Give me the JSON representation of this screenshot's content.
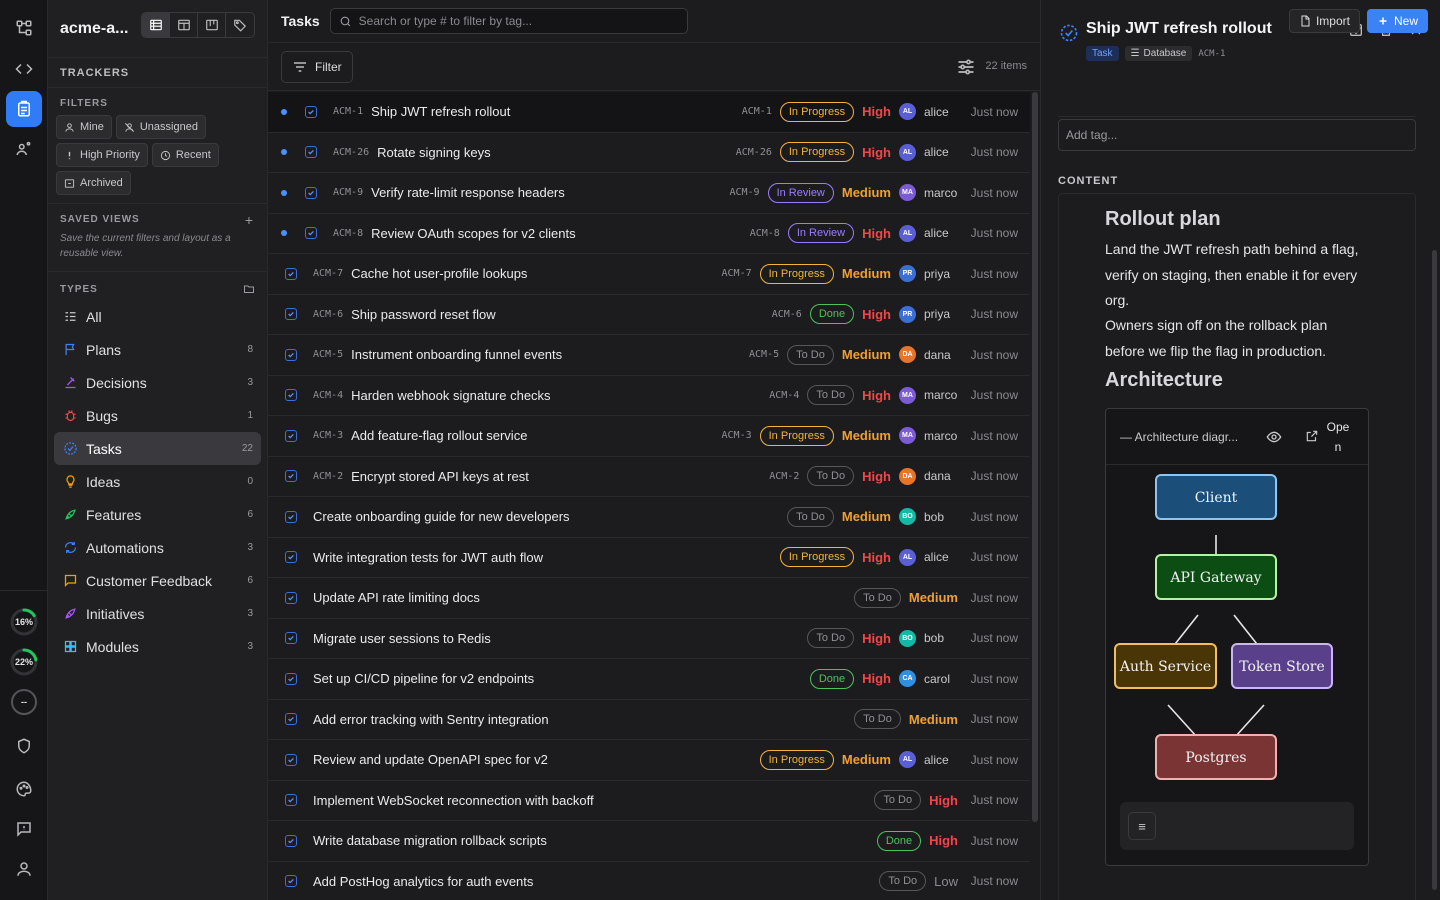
{
  "workspace": {
    "name": "acme-a..."
  },
  "sidebar": {
    "trackers_title": "TRACKERS",
    "filters_title": "FILTERS",
    "filter_chips": [
      {
        "label": "Mine",
        "icon": "user-icon"
      },
      {
        "label": "Unassigned",
        "icon": "user-off-icon"
      },
      {
        "label": "High Priority",
        "icon": "exclamation-icon"
      },
      {
        "label": "Recent",
        "icon": "clock-icon"
      },
      {
        "label": "Archived",
        "icon": "archive-icon"
      }
    ],
    "saved_views_title": "SAVED VIEWS",
    "saved_views_hint": "Save the current filters and layout as a reusable view.",
    "types_title": "TYPES",
    "types": [
      {
        "label": "All",
        "count": "",
        "color": "#c9c9cd"
      },
      {
        "label": "Plans",
        "count": "8",
        "color": "#3b82f6"
      },
      {
        "label": "Decisions",
        "count": "3",
        "color": "#a855f7"
      },
      {
        "label": "Bugs",
        "count": "1",
        "color": "#ef4444"
      },
      {
        "label": "Tasks",
        "count": "22",
        "color": "#3b82f6"
      },
      {
        "label": "Ideas",
        "count": "0",
        "color": "#f59e0b"
      },
      {
        "label": "Features",
        "count": "6",
        "color": "#22c55e"
      },
      {
        "label": "Automations",
        "count": "3",
        "color": "#3b82f6"
      },
      {
        "label": "Customer Feedback",
        "count": "6",
        "color": "#f59e0b"
      },
      {
        "label": "Initiatives",
        "count": "3",
        "color": "#a855f7"
      },
      {
        "label": "Modules",
        "count": "3",
        "color": "#38bdf8"
      }
    ]
  },
  "rail": {
    "progress": [
      {
        "label": "16%",
        "value": 0.16
      },
      {
        "label": "22%",
        "value": 0.22
      },
      {
        "label": "--",
        "value": 0
      }
    ]
  },
  "header": {
    "title": "Tasks",
    "search_placeholder": "Search or type # to filter by tag...",
    "import_label": "Import",
    "new_label": "New"
  },
  "list": {
    "filter_label": "Filter",
    "count_label": "22 items",
    "rows": [
      {
        "key": "ACM-1",
        "title": "Ship JWT refresh rollout",
        "status": "In Progress",
        "priority": "High",
        "assignee": "alice",
        "initials": "AL",
        "avatar_color": "#5b5fd6",
        "time": "Just now",
        "unread": true
      },
      {
        "key": "ACM-26",
        "title": "Rotate signing keys",
        "status": "In Progress",
        "priority": "High",
        "assignee": "alice",
        "initials": "AL",
        "avatar_color": "#5b5fd6",
        "time": "Just now",
        "unread": true
      },
      {
        "key": "ACM-9",
        "title": "Verify rate-limit response headers",
        "status": "In Review",
        "priority": "Medium",
        "assignee": "marco",
        "initials": "MA",
        "avatar_color": "#7b5bd6",
        "time": "Just now",
        "unread": true
      },
      {
        "key": "ACM-8",
        "title": "Review OAuth scopes for v2 clients",
        "status": "In Review",
        "priority": "High",
        "assignee": "alice",
        "initials": "AL",
        "avatar_color": "#5b5fd6",
        "time": "Just now",
        "unread": true
      },
      {
        "key": "ACM-7",
        "title": "Cache hot user-profile lookups",
        "status": "In Progress",
        "priority": "Medium",
        "assignee": "priya",
        "initials": "PR",
        "avatar_color": "#3b6fd6",
        "time": "Just now",
        "unread": false
      },
      {
        "key": "ACM-6",
        "title": "Ship password reset flow",
        "status": "Done",
        "priority": "High",
        "assignee": "priya",
        "initials": "PR",
        "avatar_color": "#3b6fd6",
        "time": "Just now",
        "unread": false
      },
      {
        "key": "ACM-5",
        "title": "Instrument onboarding funnel events",
        "status": "To Do",
        "priority": "Medium",
        "assignee": "dana",
        "initials": "DA",
        "avatar_color": "#e8742a",
        "time": "Just now",
        "unread": false
      },
      {
        "key": "ACM-4",
        "title": "Harden webhook signature checks",
        "status": "To Do",
        "priority": "High",
        "assignee": "marco",
        "initials": "MA",
        "avatar_color": "#7b5bd6",
        "time": "Just now",
        "unread": false
      },
      {
        "key": "ACM-3",
        "title": "Add feature-flag rollout service",
        "status": "In Progress",
        "priority": "Medium",
        "assignee": "marco",
        "initials": "MA",
        "avatar_color": "#7b5bd6",
        "time": "Just now",
        "unread": false
      },
      {
        "key": "ACM-2",
        "title": "Encrypt stored API keys at rest",
        "status": "To Do",
        "priority": "High",
        "assignee": "dana",
        "initials": "DA",
        "avatar_color": "#e8742a",
        "time": "Just now",
        "unread": false
      },
      {
        "key": "",
        "title": "Create onboarding guide for new developers",
        "status": "To Do",
        "priority": "Medium",
        "assignee": "bob",
        "initials": "BO",
        "avatar_color": "#14b8a6",
        "time": "Just now",
        "unread": false
      },
      {
        "key": "",
        "title": "Write integration tests for JWT auth flow",
        "status": "In Progress",
        "priority": "High",
        "assignee": "alice",
        "initials": "AL",
        "avatar_color": "#5b5fd6",
        "time": "Just now",
        "unread": false
      },
      {
        "key": "",
        "title": "Update API rate limiting docs",
        "status": "To Do",
        "priority": "Medium",
        "assignee": "",
        "initials": "",
        "avatar_color": "",
        "time": "Just now",
        "unread": false
      },
      {
        "key": "",
        "title": "Migrate user sessions to Redis",
        "status": "To Do",
        "priority": "High",
        "assignee": "bob",
        "initials": "BO",
        "avatar_color": "#14b8a6",
        "time": "Just now",
        "unread": false
      },
      {
        "key": "",
        "title": "Set up CI/CD pipeline for v2 endpoints",
        "status": "Done",
        "priority": "High",
        "assignee": "carol",
        "initials": "CA",
        "avatar_color": "#2f8fe0",
        "time": "Just now",
        "unread": false
      },
      {
        "key": "",
        "title": "Add error tracking with Sentry integration",
        "status": "To Do",
        "priority": "Medium",
        "assignee": "",
        "initials": "",
        "avatar_color": "",
        "time": "Just now",
        "unread": false
      },
      {
        "key": "",
        "title": "Review and update OpenAPI spec for v2",
        "status": "In Progress",
        "priority": "Medium",
        "assignee": "alice",
        "initials": "AL",
        "avatar_color": "#5b5fd6",
        "time": "Just now",
        "unread": false
      },
      {
        "key": "",
        "title": "Implement WebSocket reconnection with backoff",
        "status": "To Do",
        "priority": "High",
        "assignee": "",
        "initials": "",
        "avatar_color": "",
        "time": "Just now",
        "unread": false
      },
      {
        "key": "",
        "title": "Write database migration rollback scripts",
        "status": "Done",
        "priority": "High",
        "assignee": "",
        "initials": "",
        "avatar_color": "",
        "time": "Just now",
        "unread": false
      },
      {
        "key": "",
        "title": "Add PostHog analytics for auth events",
        "status": "To Do",
        "priority": "Low",
        "assignee": "",
        "initials": "",
        "avatar_color": "",
        "time": "Just now",
        "unread": false
      }
    ]
  },
  "detail": {
    "title": "Ship JWT refresh rollout",
    "type_tag": "Task",
    "source_tag": "Database",
    "key": "ACM-1",
    "add_tag_placeholder": "Add tag...",
    "content_label": "CONTENT",
    "heading1": "Rollout plan",
    "paragraph1": "Land the JWT refresh path behind a flag, verify on staging, then enable it for every org.",
    "paragraph2": "Owners sign off on the rollback plan before we flip the flag in production.",
    "heading2": "Architecture",
    "diagram": {
      "title": "— Architecture diagr...",
      "open_label": "Open",
      "nodes": [
        {
          "label": "Client",
          "fill": "#1b4f7a",
          "stroke": "#8ec5f0"
        },
        {
          "label": "API Gateway",
          "fill": "#0b4d12",
          "stroke": "#b9f0a8"
        },
        {
          "label": "Auth Service",
          "fill": "#4a3506",
          "stroke": "#f0c060"
        },
        {
          "label": "Token Store",
          "fill": "#5a3f8a",
          "stroke": "#c9b6f4"
        },
        {
          "label": "Postgres",
          "fill": "#7a3434",
          "stroke": "#f0b0b0"
        }
      ]
    }
  }
}
